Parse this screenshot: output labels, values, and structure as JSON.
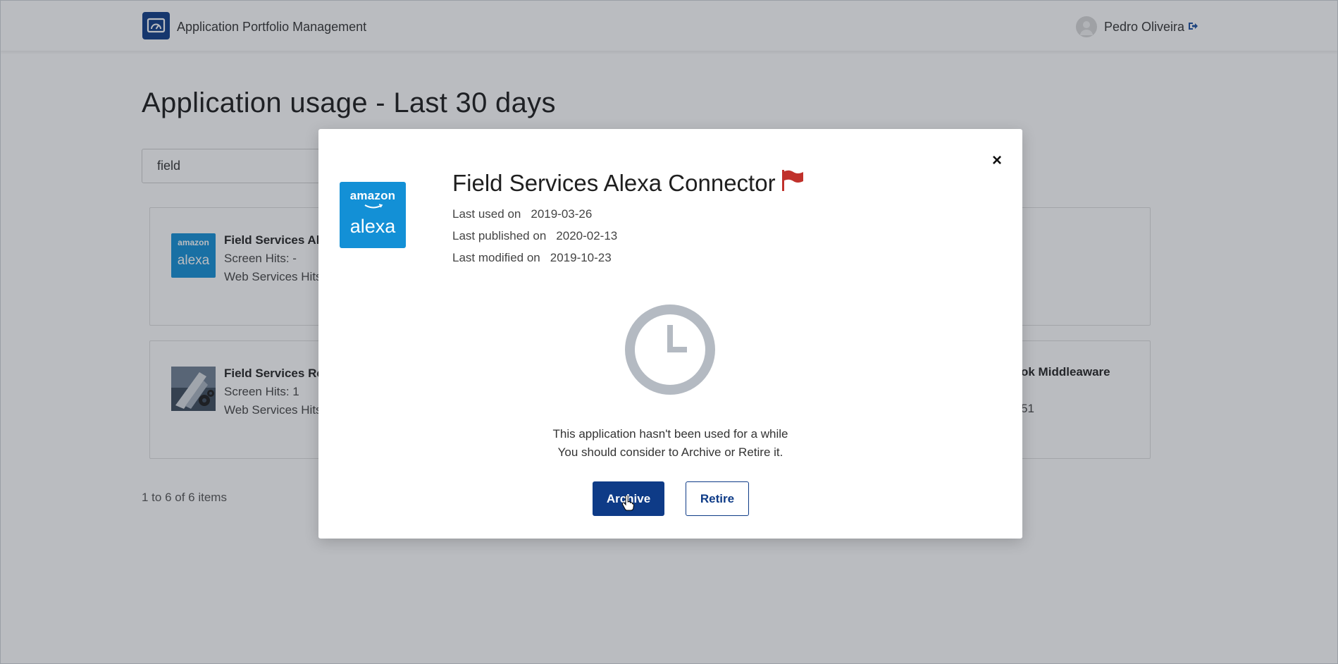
{
  "header": {
    "app_title": "Application Portfolio Management",
    "user_name": "Pedro Oliveira",
    "icons": [
      "dashboard-logo-icon",
      "user-avatar-icon",
      "sign-out-icon"
    ]
  },
  "main": {
    "title": "Application usage - Last 30 days",
    "search": {
      "value": "field",
      "placeholder": ""
    },
    "cards": [
      {
        "title": "Field Services Ale",
        "line1": "Screen Hits: -",
        "line2": "Web Services Hits"
      },
      {
        "title": "Field Services Re",
        "line1": "Screen Hits: 1",
        "line2": "Web Services Hits"
      }
    ],
    "card_right_title": "ok Middleaware",
    "card_right_line": "51",
    "pager_text": "1 to 6 of 6 items"
  },
  "modal": {
    "close_label": "×",
    "logo_top": "amazon",
    "logo_bottom": "alexa",
    "title": "Field Services Alexa Connector",
    "last_used_label": "Last used on",
    "last_used_value": "2019-03-26",
    "last_published_label": "Last published on",
    "last_published_value": "2020-02-13",
    "last_modified_label": "Last modified on",
    "last_modified_value": "2019-10-23",
    "message_line1": "This application hasn't been used for a while",
    "message_line2": "You should consider to Archive or Retire it.",
    "archive_label": "Archive",
    "retire_label": "Retire"
  },
  "colors": {
    "primary": "#0e3b87",
    "alexa_blue": "#1390d6",
    "flag_red": "#c0312b",
    "clock_gray": "#b4bac2"
  }
}
